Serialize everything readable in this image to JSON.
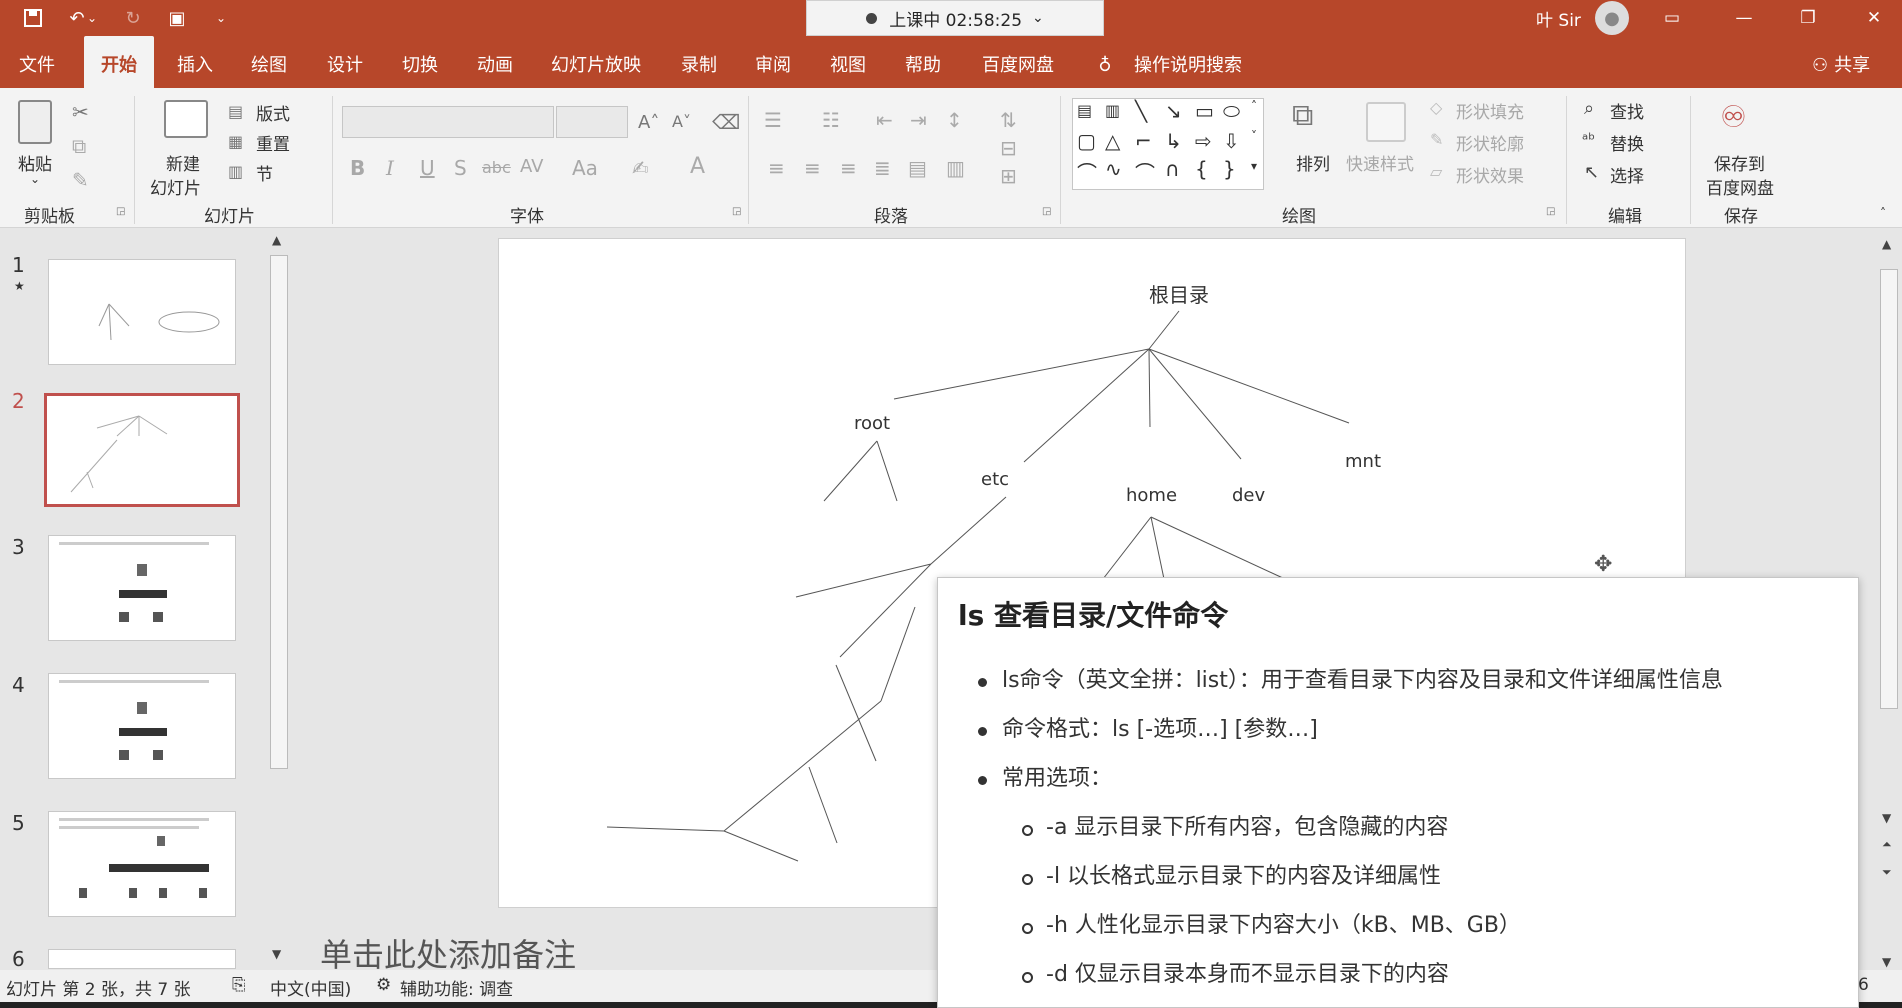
{
  "titlebar": {
    "timer_text": "上课中 02:58:25",
    "user_name": "叶 Sir"
  },
  "tabs": [
    "文件",
    "开始",
    "插入",
    "绘图",
    "设计",
    "切换",
    "动画",
    "幻灯片放映",
    "录制",
    "审阅",
    "视图",
    "帮助",
    "百度网盘"
  ],
  "active_tab": "开始",
  "tell_me": "操作说明搜索",
  "share": "共享",
  "ribbon": {
    "clipboard": {
      "paste": "粘贴",
      "label": "剪贴板"
    },
    "slides": {
      "new_slide_1": "新建",
      "new_slide_2": "幻灯片",
      "layout": "版式",
      "reset": "重置",
      "section": "节",
      "label": "幻灯片"
    },
    "font": {
      "label": "字体",
      "bold": "B",
      "italic": "I",
      "underline": "U",
      "strike": "S",
      "abc": "abc",
      "spacing": "AV",
      "case": "Aa"
    },
    "paragraph": {
      "label": "段落"
    },
    "drawing": {
      "arrange": "排列",
      "quick_styles": "快速样式",
      "shape_fill": "形状填充",
      "shape_outline": "形状轮廓",
      "shape_effects": "形状效果",
      "label": "绘图"
    },
    "editing": {
      "find": "查找",
      "replace": "替换",
      "select": "选择",
      "label": "编辑"
    },
    "save": {
      "save_to_1": "保存到",
      "save_to_2": "百度网盘",
      "label": "保存"
    }
  },
  "slide_numbers": [
    "1",
    "2",
    "3",
    "4",
    "5",
    "6"
  ],
  "slide_canvas": {
    "root_label": "根目录",
    "nodes": [
      "root",
      "etc",
      "home",
      "dev",
      "mnt"
    ]
  },
  "notes_placeholder": "单击此处添加备注",
  "popup": {
    "title": "ls 查看目录/文件命令",
    "bullets": [
      "ls命令（英文全拼：list）：用于查看目录下内容及目录和文件详细属性信息",
      "命令格式：ls [-选项…] [参数…]",
      "常用选项："
    ],
    "options": [
      "-a 显示目录下所有内容，包含隐藏的内容",
      "-l 以长格式显示目录下的内容及详细属性",
      "-h 人性化显示目录下内容大小（kB、MB、GB）",
      "-d 仅显示目录本身而不显示目录下的内容"
    ]
  },
  "status": {
    "slide_info": "幻灯片 第 2 张，共 7 张",
    "language": "中文(中国)",
    "accessibility": "辅助功能: 调查",
    "right_digit": "6"
  }
}
